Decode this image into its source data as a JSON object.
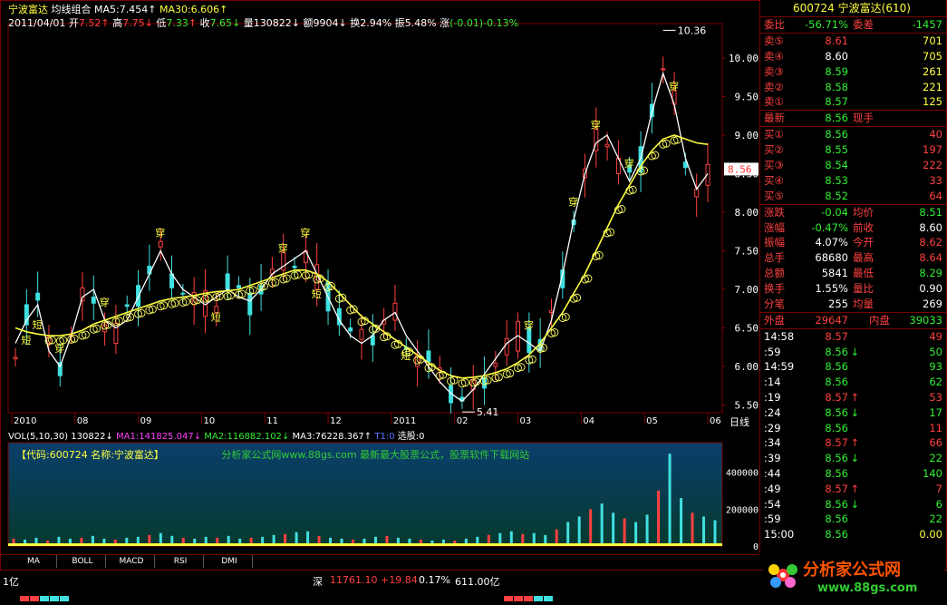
{
  "header": {
    "stock_name": "宁波富达",
    "indicator": "均线组合",
    "ma5_label": "MA5:",
    "ma5_value": "7.454",
    "ma30_label": "MA30:",
    "ma30_value": "6.606",
    "date": "2011/04/01",
    "open_label": "开",
    "open": "7.52",
    "high_label": "高",
    "high": "7.75",
    "low_label": "低",
    "low": "7.33",
    "close_label": "收",
    "close": "7.65",
    "vol_label": "量",
    "vol": "130822",
    "amt_label": "额",
    "amt": "9904",
    "turn_label": "换",
    "turn": "2.94%",
    "amp_label": "振",
    "amp": "5.48%",
    "chg_label": "涨",
    "chg": "(-0.01)-0.13%"
  },
  "chart_data": {
    "type": "line",
    "title": "宁波富达",
    "x_axis_labels": [
      "2010",
      "08",
      "09",
      "10",
      "11",
      "12",
      "2011",
      "02",
      "03",
      "04",
      "05",
      "06"
    ],
    "y_axis_labels": [
      "10.00",
      "9.50",
      "9.00",
      "8.50",
      "8.00",
      "7.50",
      "7.00",
      "6.50",
      "6.00",
      "5.50"
    ],
    "ylim": [
      5.4,
      10.4
    ],
    "period_label": "日线",
    "high_annotation": "10.36",
    "low_annotation": "5.41",
    "current_price": "8.56",
    "signal_up": "穿",
    "signal_down": "短",
    "series": [
      {
        "name": "MA5",
        "color": "#ffffff",
        "values": [
          6.3,
          6.6,
          6.8,
          6.2,
          6.0,
          6.4,
          6.9,
          7.0,
          6.6,
          6.5,
          6.6,
          6.9,
          7.2,
          7.5,
          7.2,
          7.0,
          6.9,
          6.8,
          6.9,
          7.0,
          6.9,
          6.85,
          7.0,
          7.2,
          7.3,
          7.4,
          7.5,
          7.2,
          6.9,
          6.6,
          6.4,
          6.3,
          6.4,
          6.6,
          6.7,
          6.4,
          6.2,
          6.0,
          5.8,
          5.65,
          5.55,
          5.7,
          5.9,
          6.1,
          6.3,
          6.4,
          6.3,
          6.2,
          6.6,
          7.2,
          7.9,
          8.5,
          8.9,
          9.0,
          8.7,
          8.4,
          8.7,
          9.3,
          9.8,
          9.4,
          8.7,
          8.3,
          8.5
        ]
      },
      {
        "name": "MA30",
        "color": "#ffff40",
        "values": [
          6.5,
          6.45,
          6.42,
          6.4,
          6.4,
          6.42,
          6.47,
          6.55,
          6.6,
          6.65,
          6.7,
          6.75,
          6.8,
          6.85,
          6.88,
          6.9,
          6.92,
          6.95,
          6.97,
          6.98,
          7.0,
          7.05,
          7.1,
          7.15,
          7.2,
          7.25,
          7.25,
          7.2,
          7.1,
          6.95,
          6.8,
          6.65,
          6.55,
          6.45,
          6.35,
          6.25,
          6.15,
          6.05,
          5.95,
          5.88,
          5.85,
          5.86,
          5.88,
          5.92,
          5.97,
          6.05,
          6.15,
          6.3,
          6.5,
          6.7,
          6.95,
          7.2,
          7.5,
          7.8,
          8.1,
          8.35,
          8.6,
          8.8,
          8.95,
          9.0,
          8.95,
          8.9,
          8.88
        ]
      }
    ],
    "volume": {
      "indicator_label": "VOL(5,10,30)",
      "value": "130822",
      "ma1_label": "MA1:",
      "ma1": "141825.047",
      "ma2_label": "MA2:",
      "ma2": "116882.102",
      "ma3_label": "MA3:",
      "ma3": "76228.367",
      "t1_label": "T1:",
      "t1": "0",
      "select_label": "选股:",
      "select": "0",
      "y_axis_labels": [
        "400000",
        "200000",
        "0"
      ],
      "ylim": [
        0,
        560000
      ],
      "values": [
        40,
        35,
        45,
        30,
        50,
        40,
        45,
        55,
        40,
        35,
        45,
        50,
        60,
        70,
        55,
        45,
        40,
        50,
        45,
        55,
        40,
        45,
        50,
        60,
        65,
        75,
        80,
        55,
        45,
        40,
        35,
        40,
        50,
        55,
        45,
        40,
        35,
        30,
        35,
        30,
        40,
        50,
        60,
        70,
        80,
        65,
        70,
        60,
        90,
        130,
        160,
        200,
        230,
        180,
        150,
        130,
        170,
        300,
        500,
        260,
        180,
        160,
        140
      ],
      "banner_text": "【代码:600724 名称:宁波富达】",
      "banner_site": "分析家公式网www.88gs.com 最新最大股票公式，股票软件下载网站"
    }
  },
  "panel": {
    "code": "600724",
    "name": "宁波富达",
    "count": "(610)",
    "webi_label": "委比",
    "webi": "-56.71%",
    "weicha_label": "委差",
    "weicha": "-1457",
    "asks": [
      {
        "label": "卖⑤",
        "price": "8.61",
        "vol": "701",
        "color": "#ff4040"
      },
      {
        "label": "卖④",
        "price": "8.60",
        "vol": "705",
        "color": "#ffffff"
      },
      {
        "label": "卖③",
        "price": "8.59",
        "vol": "261",
        "color": "#33ee33"
      },
      {
        "label": "卖②",
        "price": "8.58",
        "vol": "221",
        "color": "#33ee33"
      },
      {
        "label": "卖①",
        "price": "8.57",
        "vol": "125",
        "color": "#33ee33"
      }
    ],
    "latest_label": "最新",
    "latest": "8.56",
    "xianshou_label": "现手",
    "xianshou": "",
    "bids": [
      {
        "label": "买①",
        "price": "8.56",
        "vol": "40",
        "color": "#33ee33"
      },
      {
        "label": "买②",
        "price": "8.55",
        "vol": "197",
        "color": "#33ee33"
      },
      {
        "label": "买③",
        "price": "8.54",
        "vol": "222",
        "color": "#33ee33"
      },
      {
        "label": "买④",
        "price": "8.53",
        "vol": "33",
        "color": "#33ee33"
      },
      {
        "label": "买⑤",
        "price": "8.52",
        "vol": "64",
        "color": "#33ee33"
      }
    ],
    "stats": [
      {
        "l1": "涨跌",
        "v1": "-0.04",
        "c1": "#33ee33",
        "l2": "均价",
        "v2": "8.51",
        "c2": "#33ee33"
      },
      {
        "l1": "涨幅",
        "v1": "-0.47%",
        "c1": "#33ee33",
        "l2": "前收",
        "v2": "8.60",
        "c2": "#ffffff"
      },
      {
        "l1": "振幅",
        "v1": "4.07%",
        "c1": "#ffffff",
        "l2": "今开",
        "v2": "8.62",
        "c2": "#ff4040"
      },
      {
        "l1": "总手",
        "v1": "68680",
        "c1": "#ffffff",
        "l2": "最高",
        "v2": "8.64",
        "c2": "#ff4040"
      },
      {
        "l1": "总额",
        "v1": "5841",
        "c1": "#ffffff",
        "l2": "最低",
        "v2": "8.29",
        "c2": "#33ee33"
      },
      {
        "l1": "换手",
        "v1": "1.55%",
        "c1": "#ffffff",
        "l2": "量比",
        "v2": "0.90",
        "c2": "#ffffff"
      },
      {
        "l1": "分笔",
        "v1": "255",
        "c1": "#ffffff",
        "l2": "均量",
        "v2": "269",
        "c2": "#ffffff"
      }
    ],
    "waipan_label": "外盘",
    "waipan": "29647",
    "neipan_label": "内盘",
    "neipan": "39033",
    "ticks": [
      {
        "t": "14:58",
        "p": "8.57",
        "a": "",
        "v": "49",
        "vc": "#ff4040"
      },
      {
        "t": ":59",
        "p": "8.56",
        "a": "↓",
        "v": "50",
        "vc": "#33ee33"
      },
      {
        "t": "14:59",
        "p": "8.56",
        "a": "",
        "v": "93",
        "vc": "#33ee33"
      },
      {
        "t": ":14",
        "p": "8.56",
        "a": "",
        "v": "62",
        "vc": "#33ee33"
      },
      {
        "t": ":19",
        "p": "8.57",
        "a": "↑",
        "v": "53",
        "vc": "#ff4040"
      },
      {
        "t": ":24",
        "p": "8.56",
        "a": "↓",
        "v": "17",
        "vc": "#33ee33"
      },
      {
        "t": ":29",
        "p": "8.56",
        "a": "",
        "v": "11",
        "vc": "#ff4040"
      },
      {
        "t": ":34",
        "p": "8.57",
        "a": "↑",
        "v": "66",
        "vc": "#ff4040"
      },
      {
        "t": ":39",
        "p": "8.56",
        "a": "↓",
        "v": "22",
        "vc": "#33ee33"
      },
      {
        "t": ":44",
        "p": "8.56",
        "a": "",
        "v": "140",
        "vc": "#33ee33"
      },
      {
        "t": ":49",
        "p": "8.57",
        "a": "↑",
        "v": "7",
        "vc": "#ff4040"
      },
      {
        "t": ":54",
        "p": "8.56",
        "a": "↓",
        "v": "6",
        "vc": "#33ee33"
      },
      {
        "t": ":59",
        "p": "8.56",
        "a": "",
        "v": "22",
        "vc": "#33ee33"
      },
      {
        "t": "15:00",
        "p": "8.56",
        "a": "",
        "v": "0.00",
        "vc": "#ffff40"
      }
    ]
  },
  "tabs": [
    "MA",
    "BOLL",
    "MACD",
    "RSI",
    "DMI"
  ],
  "status": {
    "left_label": "1亿",
    "index_name": "深",
    "index_value": "11761.10",
    "index_change": "+19.84",
    "index_pct": "0.17%",
    "index_amount": "611.00亿"
  },
  "logo": {
    "text": "分析家公式网",
    "url_text": "www.88gs.com"
  },
  "colors": {
    "up": "#ff4040",
    "down": "#33ee33",
    "ma5": "#ffffff",
    "ma30": "#ffff40",
    "border": "#7a0000",
    "vol_bg_top": "#0a4a7a"
  }
}
